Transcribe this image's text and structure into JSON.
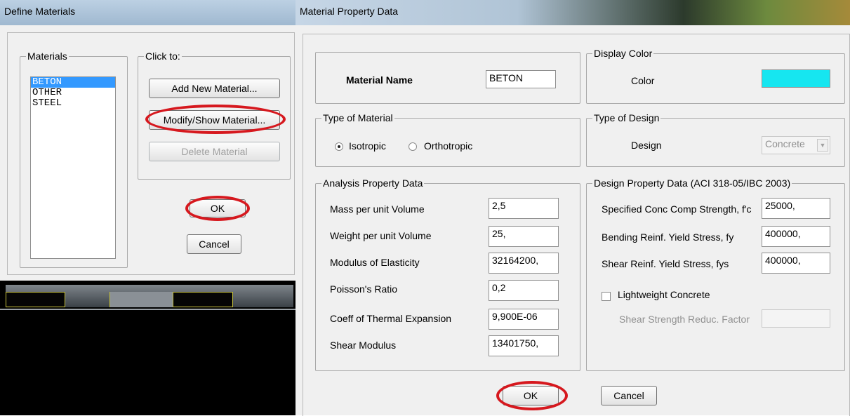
{
  "define_window": {
    "title": "Define Materials",
    "materials_group": "Materials",
    "materials": [
      "BETON",
      "OTHER",
      "STEEL"
    ],
    "click_to_group": "Click to:",
    "add_button": "Add New Material...",
    "modify_button": "Modify/Show Material...",
    "delete_button": "Delete Material",
    "ok_button": "OK",
    "cancel_button": "Cancel"
  },
  "property_window": {
    "title": "Material Property Data",
    "material_name_label": "Material Name",
    "material_name_value": "BETON",
    "display_color_group": "Display Color",
    "color_label": "Color",
    "color_value": "#16e6f0",
    "type_of_material_group": "Type of Material",
    "isotropic_label": "Isotropic",
    "orthotropic_label": "Orthotropic",
    "selected_type": "Isotropic",
    "type_of_design_group": "Type of Design",
    "design_label": "Design",
    "design_value": "Concrete",
    "analysis_group": "Analysis Property Data",
    "analysis_rows": [
      {
        "label": "Mass per unit Volume",
        "value": "2,5"
      },
      {
        "label": "Weight per unit Volume",
        "value": "25,"
      },
      {
        "label": "Modulus of Elasticity",
        "value": "32164200,"
      },
      {
        "label": "Poisson's Ratio",
        "value": "0,2"
      },
      {
        "label": "Coeff of Thermal Expansion",
        "value": "9,900E-06"
      },
      {
        "label": "Shear Modulus",
        "value": "13401750,"
      }
    ],
    "design_property_group": "Design Property Data (ACI 318-05/IBC 2003)",
    "design_rows": [
      {
        "label": "Specified Conc Comp Strength, f'c",
        "value": "25000,"
      },
      {
        "label": "Bending Reinf. Yield Stress, fy",
        "value": "400000,"
      },
      {
        "label": "Shear Reinf. Yield Stress, fys",
        "value": "400000,"
      }
    ],
    "lightweight_label": "Lightweight Concrete",
    "shear_reduc_label": "Shear Strength Reduc. Factor",
    "shear_reduc_value": "",
    "ok_button": "OK",
    "cancel_button": "Cancel"
  },
  "colors": {
    "highlight_oval": "#d6181e",
    "selection": "#3399ff"
  }
}
